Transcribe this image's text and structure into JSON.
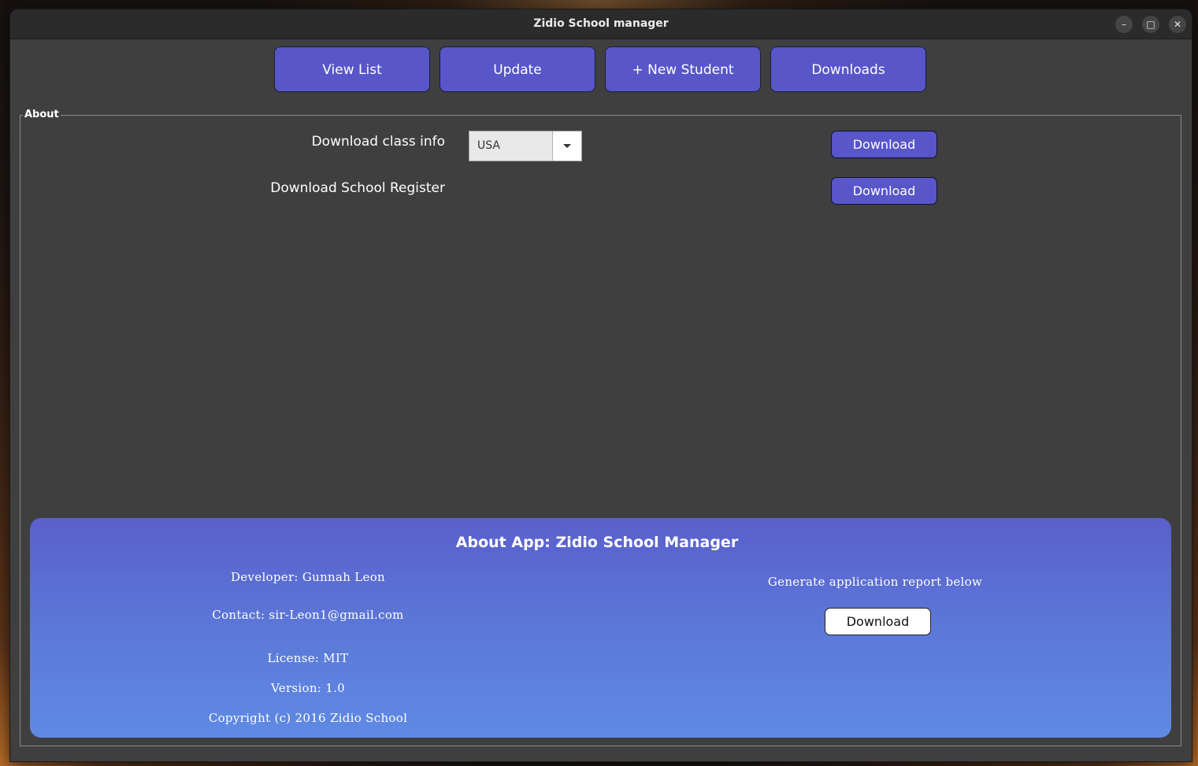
{
  "window": {
    "title": "Zidio School manager",
    "controls": {
      "minimize": "–",
      "maximize": "□",
      "close": "✕"
    }
  },
  "nav": {
    "buttons": [
      "View List",
      "Update",
      "+ New Student",
      "Downloads"
    ]
  },
  "about_section": {
    "legend": "About",
    "rows": [
      {
        "label": "Download class info",
        "button": "Download"
      },
      {
        "label": "Download School Register",
        "button": "Download"
      }
    ],
    "class_select": {
      "value": "USA"
    }
  },
  "about_panel": {
    "title": "About App: Zidio School Manager",
    "developer": "Developer: Gunnah Leon",
    "contact": "Contact: sir-Leon1@gmail.com",
    "license": "License: MIT",
    "version": "Version: 1.0",
    "copyright": "Copyright (c) 2016 Zidio School",
    "report_text": "Generate application report below",
    "report_button": "Download"
  },
  "colors": {
    "accent": "#5856c9",
    "window_bg": "#3f3f3f",
    "titlebar_bg": "#2b2b2b"
  }
}
